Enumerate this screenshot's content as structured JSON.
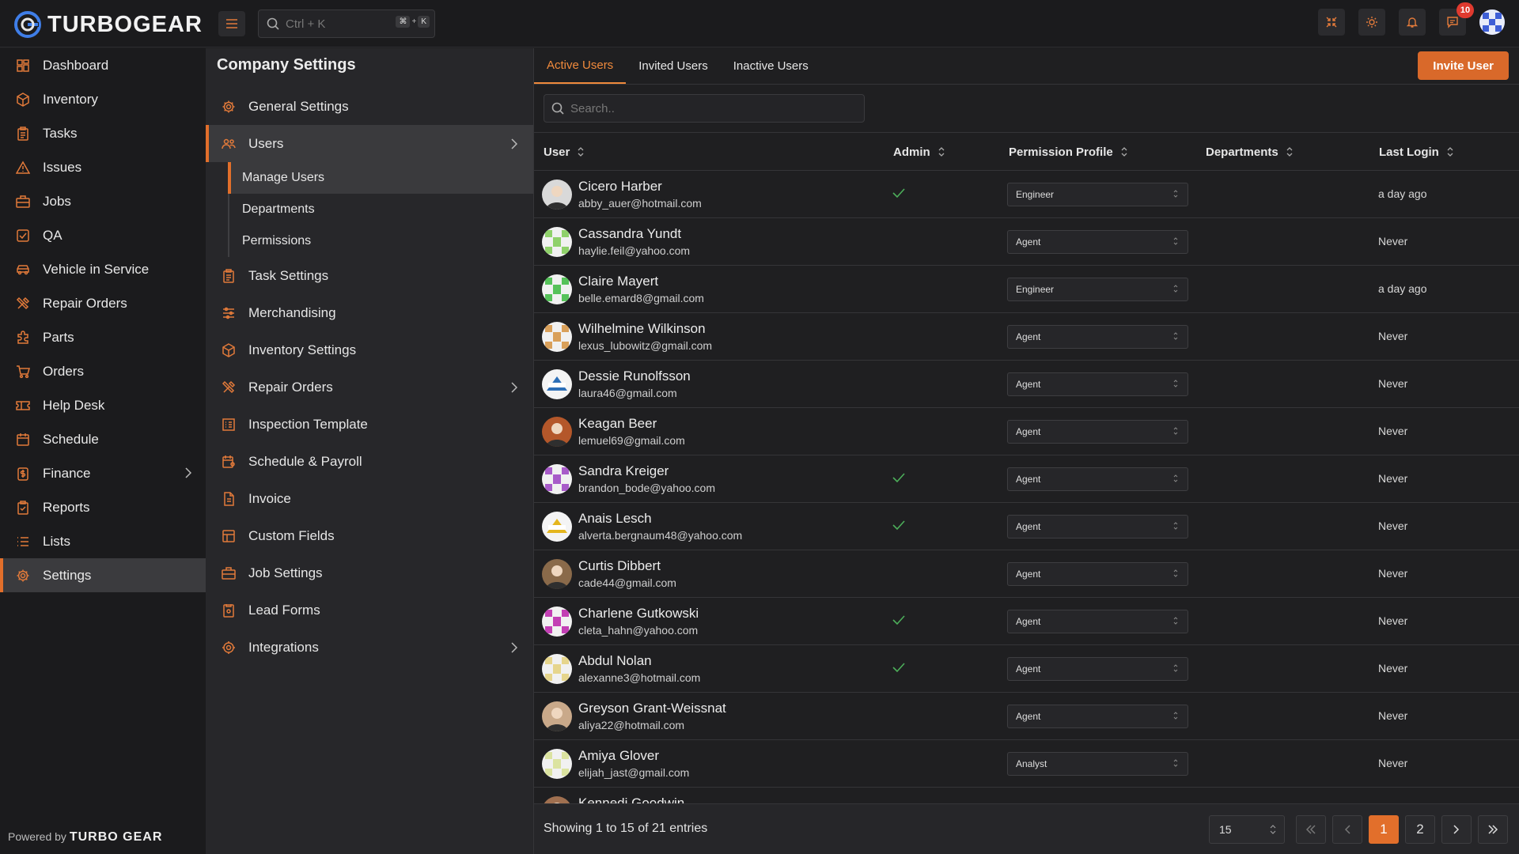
{
  "app": {
    "name": "TURBOGEAR",
    "powered_by": "Powered by",
    "powered_brand": "TURBO GEAR"
  },
  "topbar": {
    "search_placeholder": "Ctrl + K",
    "shortcut_mod": "⌘",
    "shortcut_plus": "+",
    "shortcut_key": "K",
    "notification_count": "10"
  },
  "nav": [
    {
      "label": "Dashboard",
      "icon": "dashboard-icon"
    },
    {
      "label": "Inventory",
      "icon": "box-icon"
    },
    {
      "label": "Tasks",
      "icon": "clipboard-icon"
    },
    {
      "label": "Issues",
      "icon": "warning-icon"
    },
    {
      "label": "Jobs",
      "icon": "briefcase-icon"
    },
    {
      "label": "QA",
      "icon": "checkbox-icon"
    },
    {
      "label": "Vehicle in Service",
      "icon": "car-icon"
    },
    {
      "label": "Repair Orders",
      "icon": "tools-icon"
    },
    {
      "label": "Parts",
      "icon": "puzzle-icon"
    },
    {
      "label": "Orders",
      "icon": "cart-icon"
    },
    {
      "label": "Help Desk",
      "icon": "ticket-icon"
    },
    {
      "label": "Schedule",
      "icon": "calendar-icon"
    },
    {
      "label": "Finance",
      "icon": "dollar-icon",
      "has_children": true
    },
    {
      "label": "Reports",
      "icon": "report-icon"
    },
    {
      "label": "Lists",
      "icon": "list-icon"
    },
    {
      "label": "Settings",
      "icon": "gear-icon",
      "active": true
    }
  ],
  "settings": {
    "title": "Company Settings",
    "items": [
      {
        "label": "General Settings",
        "icon": "gear-icon"
      },
      {
        "label": "Users",
        "icon": "users-icon",
        "active": true,
        "has_children": true
      },
      {
        "label": "Task Settings",
        "icon": "clipboard-icon"
      },
      {
        "label": "Merchandising",
        "icon": "sliders-icon"
      },
      {
        "label": "Inventory Settings",
        "icon": "box-icon"
      },
      {
        "label": "Repair Orders",
        "icon": "tools-icon",
        "has_children": true
      },
      {
        "label": "Inspection Template",
        "icon": "checklist-icon"
      },
      {
        "label": "Schedule & Payroll",
        "icon": "calendar-user-icon"
      },
      {
        "label": "Invoice",
        "icon": "invoice-icon"
      },
      {
        "label": "Custom Fields",
        "icon": "table-icon"
      },
      {
        "label": "Job Settings",
        "icon": "briefcase-icon"
      },
      {
        "label": "Lead Forms",
        "icon": "form-icon"
      },
      {
        "label": "Integrations",
        "icon": "integrations-icon",
        "has_children": true
      }
    ],
    "users_sub": [
      {
        "label": "Manage Users",
        "active": true
      },
      {
        "label": "Departments"
      },
      {
        "label": "Permissions"
      }
    ]
  },
  "tabs": [
    {
      "label": "Active Users",
      "active": true
    },
    {
      "label": "Invited Users"
    },
    {
      "label": "Inactive Users"
    }
  ],
  "invite_label": "Invite User",
  "table_search_placeholder": "Search..",
  "columns": {
    "user": "User",
    "admin": "Admin",
    "permission": "Permission Profile",
    "departments": "Departments",
    "last_login": "Last Login"
  },
  "users": [
    {
      "name": "Cicero Harber",
      "email": "abby_auer@hotmail.com",
      "admin": true,
      "profile": "Engineer",
      "last_login": "a day ago",
      "avatar": "photo",
      "color": "#d9d9d9"
    },
    {
      "name": "Cassandra Yundt",
      "email": "haylie.feil@yahoo.com",
      "admin": false,
      "profile": "Agent",
      "last_login": "Never",
      "avatar": "pattern",
      "color": "#8fd16a"
    },
    {
      "name": "Claire Mayert",
      "email": "belle.emard8@gmail.com",
      "admin": false,
      "profile": "Engineer",
      "last_login": "a day ago",
      "avatar": "pattern",
      "color": "#56c25a"
    },
    {
      "name": "Wilhelmine Wilkinson",
      "email": "lexus_lubowitz@gmail.com",
      "admin": false,
      "profile": "Agent",
      "last_login": "Never",
      "avatar": "pattern",
      "color": "#d9a05a"
    },
    {
      "name": "Dessie Runolfsson",
      "email": "laura46@gmail.com",
      "admin": false,
      "profile": "Agent",
      "last_login": "Never",
      "avatar": "logo",
      "color": "#2d6fb7"
    },
    {
      "name": "Keagan Beer",
      "email": "lemuel69@gmail.com",
      "admin": false,
      "profile": "Agent",
      "last_login": "Never",
      "avatar": "photo",
      "color": "#b4572a"
    },
    {
      "name": "Sandra Kreiger",
      "email": "brandon_bode@yahoo.com",
      "admin": true,
      "profile": "Agent",
      "last_login": "Never",
      "avatar": "pattern",
      "color": "#a85bc9"
    },
    {
      "name": "Anais Lesch",
      "email": "alverta.bergnaum48@yahoo.com",
      "admin": true,
      "profile": "Agent",
      "last_login": "Never",
      "avatar": "logo",
      "color": "#e4b61e"
    },
    {
      "name": "Curtis Dibbert",
      "email": "cade44@gmail.com",
      "admin": false,
      "profile": "Agent",
      "last_login": "Never",
      "avatar": "photo",
      "color": "#8a6a4a"
    },
    {
      "name": "Charlene Gutkowski",
      "email": "cleta_hahn@yahoo.com",
      "admin": true,
      "profile": "Agent",
      "last_login": "Never",
      "avatar": "pattern",
      "color": "#c33fb4"
    },
    {
      "name": "Abdul Nolan",
      "email": "alexanne3@hotmail.com",
      "admin": true,
      "profile": "Agent",
      "last_login": "Never",
      "avatar": "pattern",
      "color": "#e6d58c"
    },
    {
      "name": "Greyson Grant-Weissnat",
      "email": "aliya22@hotmail.com",
      "admin": false,
      "profile": "Agent",
      "last_login": "Never",
      "avatar": "photo",
      "color": "#c9a98a"
    },
    {
      "name": "Amiya Glover",
      "email": "elijah_jast@gmail.com",
      "admin": false,
      "profile": "Analyst",
      "last_login": "Never",
      "avatar": "pattern",
      "color": "#dbe3a0"
    },
    {
      "name": "Kennedi Goodwin",
      "email": "",
      "admin": false,
      "profile": "",
      "last_login": "",
      "avatar": "photo",
      "color": "#a07050"
    }
  ],
  "footer": {
    "showing": "Showing 1 to 15 of 21 entries",
    "page_size": "15",
    "pages": [
      "1",
      "2"
    ],
    "current_page": "1"
  },
  "colors": {
    "accent": "#e26f2b",
    "check": "#4cae5a"
  }
}
